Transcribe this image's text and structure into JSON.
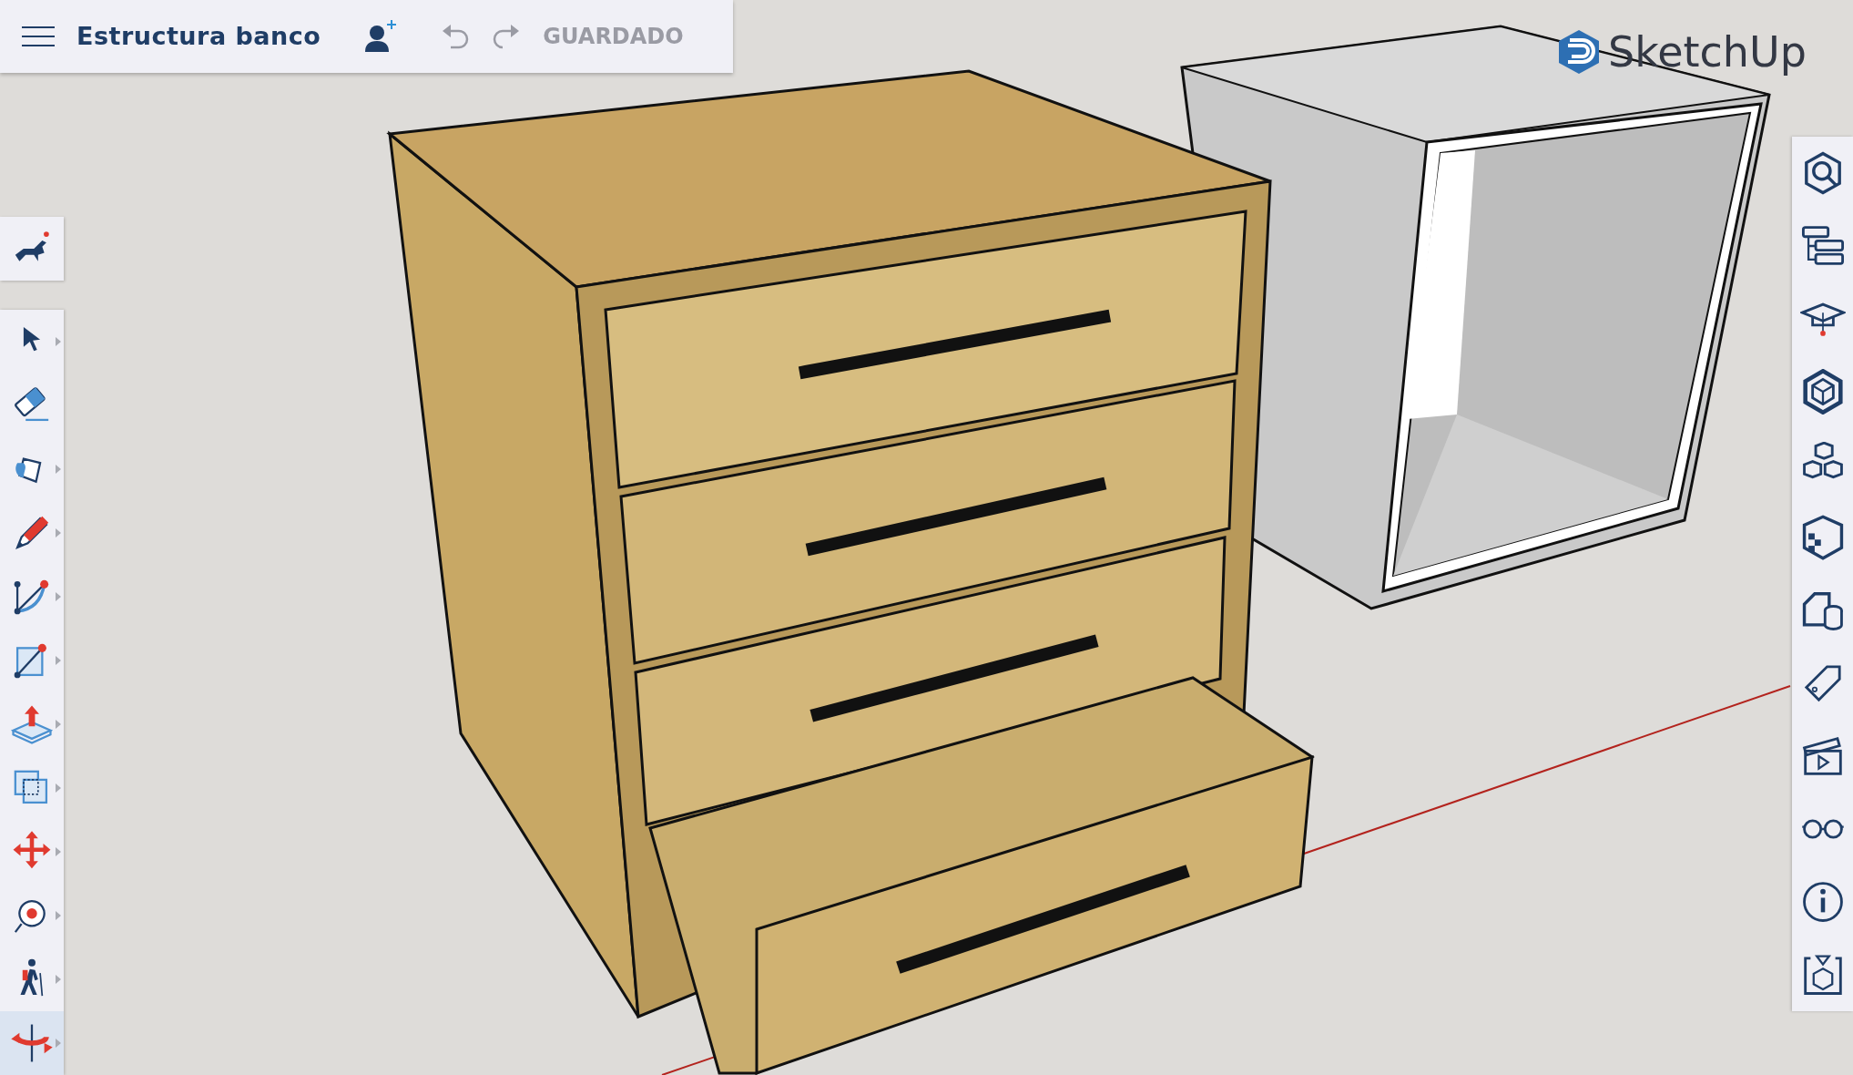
{
  "top_bar": {
    "title": "Estructura banco",
    "status": "GUARDADO"
  },
  "logo": {
    "text": "SketchUp"
  },
  "instructor": {
    "kind": "instructor"
  },
  "tools": [
    {
      "kind": "select",
      "selected": false,
      "has_menu": true
    },
    {
      "kind": "eraser",
      "selected": false,
      "has_menu": false
    },
    {
      "kind": "paint",
      "selected": false,
      "has_menu": true
    },
    {
      "kind": "pencil",
      "selected": false,
      "has_menu": true
    },
    {
      "kind": "arc",
      "selected": false,
      "has_menu": true
    },
    {
      "kind": "rectangle",
      "selected": false,
      "has_menu": true
    },
    {
      "kind": "pushpull",
      "selected": false,
      "has_menu": true
    },
    {
      "kind": "offset",
      "selected": false,
      "has_menu": true
    },
    {
      "kind": "move",
      "selected": false,
      "has_menu": true
    },
    {
      "kind": "tape",
      "selected": false,
      "has_menu": true
    },
    {
      "kind": "walk",
      "selected": false,
      "has_menu": true
    },
    {
      "kind": "orbit",
      "selected": true,
      "has_menu": true
    }
  ],
  "panels": [
    {
      "kind": "search"
    },
    {
      "kind": "outliner"
    },
    {
      "kind": "learn"
    },
    {
      "kind": "components"
    },
    {
      "kind": "cubes"
    },
    {
      "kind": "materials"
    },
    {
      "kind": "shapes"
    },
    {
      "kind": "tags"
    },
    {
      "kind": "scenes"
    },
    {
      "kind": "display"
    },
    {
      "kind": "info"
    },
    {
      "kind": "export"
    }
  ]
}
